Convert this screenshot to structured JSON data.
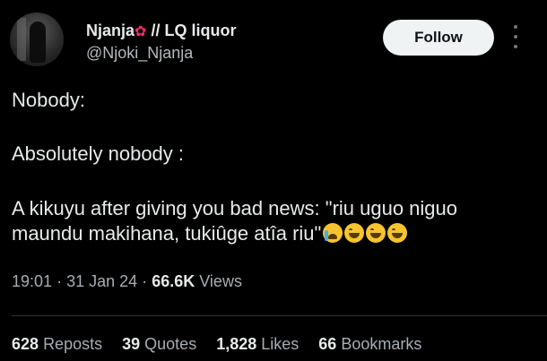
{
  "author": {
    "display_name_prefix": "Njanja",
    "display_name_emoji": "✿",
    "display_name_suffix": "// LQ liquor",
    "handle": "@Njoki_Njanja"
  },
  "follow_label": "Follow",
  "body": {
    "line1": "Nobody:",
    "line2": "Absolutely nobody :",
    "line3": "A kikuyu after giving you bad news: \"riu uguo niguo",
    "line4": "maundu makihana, tukiûge atîa riu\""
  },
  "emojis": [
    "loudly-crying-face",
    "face-with-tears-of-joy",
    "face-with-tears-of-joy",
    "face-with-tears-of-joy"
  ],
  "meta": {
    "time": "19:01",
    "date": "31 Jan 24",
    "views_count": "66.6K",
    "views_label": "Views",
    "separator": "·"
  },
  "stats": {
    "reposts_count": "628",
    "reposts_label": "Reposts",
    "quotes_count": "39",
    "quotes_label": "Quotes",
    "likes_count": "1,828",
    "likes_label": "Likes",
    "bookmarks_count": "66",
    "bookmarks_label": "Bookmarks"
  },
  "colors": {
    "background": "#000000",
    "text": "#e7e9ea",
    "secondary": "#a8adb2",
    "button_bg": "#eff3f4",
    "flower": "#ff2a6d"
  }
}
